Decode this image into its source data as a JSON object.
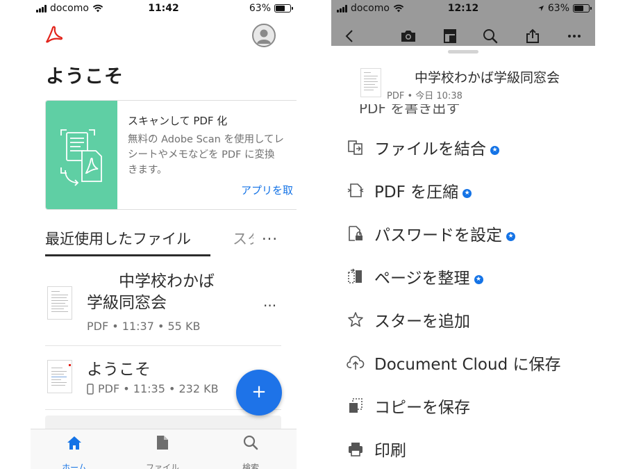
{
  "left": {
    "status": {
      "carrier": "docomo",
      "time": "11:42",
      "battery": "63%",
      "battery_level": 0.63
    },
    "header": {
      "logo_icon": "acrobat-logo-icon",
      "avatar_icon": "user-avatar-icon"
    },
    "title": "ようこそ",
    "scan_card": {
      "title": "スキャンして PDF 化",
      "description": "無料の Adobe Scan を使用してレ\nシートやメモなどを PDF に変換\nきます。",
      "link": "アプリを取"
    },
    "tabs": {
      "recent": "最近使用したファイル",
      "starred": "スター",
      "more": "..."
    },
    "files": [
      {
        "name": "　　中学校わかば\n学級同窓会",
        "meta": "PDF • 11:37 • 55 KB",
        "more": "..."
      },
      {
        "name": "ようこそ",
        "meta": "PDF • 11:35 • 232 KB"
      }
    ],
    "fab": "+",
    "nav": {
      "home": "ホーム",
      "files": "ファイル",
      "search": "検索"
    }
  },
  "right": {
    "status": {
      "carrier": "docomo",
      "time": "12:12",
      "battery": "63%",
      "battery_level": 0.63
    },
    "document": {
      "title": "中学校わかば学級同窓会",
      "meta": "PDF  •  今日 10:38"
    },
    "partial_item": "PDF を書き出す",
    "menu": [
      {
        "label": "ファイルを結合",
        "icon": "combine-files-icon",
        "premium": true
      },
      {
        "label": "PDF を圧縮",
        "icon": "compress-pdf-icon",
        "premium": true
      },
      {
        "label": "パスワードを設定",
        "icon": "set-password-icon",
        "premium": true
      },
      {
        "label": "ページを整理",
        "icon": "organize-pages-icon",
        "premium": true
      },
      {
        "label": "スターを追加",
        "icon": "star-icon",
        "premium": false
      },
      {
        "label": "Document Cloud に保存",
        "icon": "cloud-upload-icon",
        "premium": false
      },
      {
        "label": "コピーを保存",
        "icon": "save-copy-icon",
        "premium": false
      },
      {
        "label": "印刷",
        "icon": "print-icon",
        "premium": false
      }
    ],
    "premium_mark": "★"
  },
  "colors": {
    "accent": "#1473e6",
    "scan_card": "#5fcfa4",
    "acrobat_red": "#e2231a",
    "fab": "#1e73e8"
  }
}
